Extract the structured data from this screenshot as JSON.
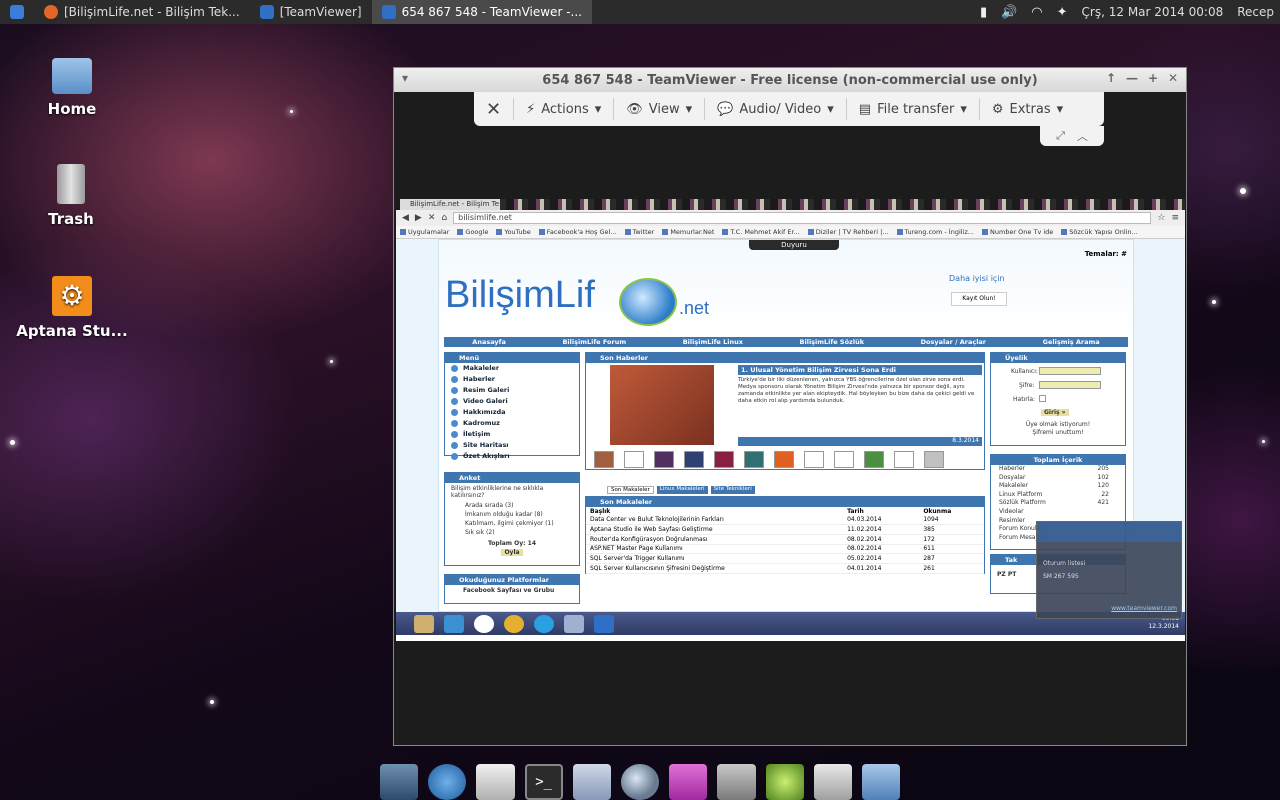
{
  "top_panel": {
    "tasks": [
      {
        "label": "[BilişimLife.net - Bilişim Tek...",
        "icon": "firefox-icon"
      },
      {
        "label": "[TeamViewer]",
        "icon": "teamviewer-icon"
      },
      {
        "label": "654 867 548 - TeamViewer -...",
        "icon": "teamviewer-icon",
        "active": true
      }
    ],
    "datetime": "Çrş, 12 Mar 2014 00:08",
    "user": "Recep"
  },
  "desktop_icons": [
    {
      "label": "Home",
      "icon": "home-folder-icon"
    },
    {
      "label": "Trash",
      "icon": "trash-icon"
    },
    {
      "label": "Aptana Stu...",
      "icon": "aptana-gear-icon"
    }
  ],
  "teamviewer": {
    "title": "654 867 548 - TeamViewer - Free license (non-commercial use only)",
    "toolbar": {
      "actions": "Actions",
      "view": "View",
      "audio_video": "Audio/ Video",
      "file_transfer": "File transfer",
      "extras": "Extras"
    }
  },
  "remote": {
    "tab_title": "BilişimLife.net - Bilişim Te",
    "url": "bilisimlife.net",
    "bookmarks": [
      "Uygulamalar",
      "Google",
      "YouTube",
      "Facebook'a Hoş Gel...",
      "Twitter",
      "Memurlar.Net",
      "T.C. Mehmet Akif Er...",
      "Diziler | TV Rehberi |...",
      "Tureng.com - İngiliz...",
      "Number One Tv ide",
      "Sözcük Yapısı Onlin..."
    ],
    "site": {
      "duyuru": "Duyuru",
      "temalar": "Temalar: #",
      "logo": "BilişimLif",
      "logo_suffix": ".net",
      "daha": "Daha iyisi için",
      "kayit": "Kayıt Olun!",
      "nav": [
        "Anasayfa",
        "BilişimLife Forum",
        "BilişimLife Linux",
        "BilişimLife Sözlük",
        "Dosyalar / Araçlar",
        "Gelişmiş Arama"
      ],
      "menu": {
        "title": "Menü",
        "items": [
          "Makaleler",
          "Haberler",
          "Resim Galeri",
          "Video Galeri",
          "Hakkımızda",
          "Kadromuz",
          "İletişim",
          "Site Haritası",
          "Özet Akışları"
        ]
      },
      "anket": {
        "title": "Anket",
        "question": "Bilişim etkinliklerine ne sıklıkla katılırsınız?",
        "options": [
          "Arada sırada  (3)",
          "İmkanım olduğu kadar  (8)",
          "Katılmam, ilgimi çekmiyor  (1)",
          "Sık sık  (2)"
        ],
        "total": "Toplam Oy: 14",
        "button": "Oyla"
      },
      "platform": {
        "title": "Okuduğunuz Platformlar",
        "item": "Facebook Sayfası ve Grubu"
      },
      "son_haberler": {
        "title": "Son Haberler",
        "headline": "1. Ulusal Yönetim Bilişim Zirvesi Sona Erdi",
        "body": "Türkiye'de bir ilki düzenlenen, yalnızca YBS öğrencilerine özel olan zirve sona erdi. Medya sponsoru olarak Yönetim Bilişim Zirvesi'nde yalnızca bir sponsor değil, aynı zamanda etkinlikte yer alan ekipteydik. Hal böyleyken bu bize daha da çekici geldi ve daha etkin rol alıp yardımda bulunduk.",
        "date": "8.3.2014"
      },
      "tabs": [
        "Son Makaleler",
        "Linux Makaleleri",
        "Site Teknikleri"
      ],
      "son_makaleler": {
        "title": "Son Makaleler",
        "headers": [
          "Başlık",
          "Tarih",
          "Okunma"
        ],
        "rows": [
          [
            "Data Center ve Bulut Teknolojilerinin Farkları",
            "04.03.2014",
            "1094"
          ],
          [
            "Aptana Studio ile Web Sayfası Geliştirme",
            "11.02.2014",
            "385"
          ],
          [
            "Router'da Konfigürasyon Doğrulanması",
            "08.02.2014",
            "172"
          ],
          [
            "ASP.NET Master Page Kullanımı",
            "08.02.2014",
            "611"
          ],
          [
            "SQL Server'da Trigger Kullanımı",
            "05.02.2014",
            "287"
          ],
          [
            "SQL Server Kullanıcısının Şifresini Değiştirme",
            "04.01.2014",
            "261"
          ]
        ]
      },
      "uyelik": {
        "title": "Üyelik",
        "kullanici": "Kullanıcı:",
        "sifre": "Şifre:",
        "hatirla": "Hatırla:",
        "giris": "Giriş »",
        "uye_olmak": "Üye olmak istiyorum!",
        "sifremi": "Şifremi unuttum!"
      },
      "toplam": {
        "title": "Toplam İçerik",
        "rows": [
          [
            "Haberler",
            "205"
          ],
          [
            "Dosyalar",
            "102"
          ],
          [
            "Makaleler",
            "120"
          ],
          [
            "Linux Platform",
            "22"
          ],
          [
            "Sözlük Platform",
            "421"
          ],
          [
            "Videolar",
            ""
          ],
          [
            "Resimler",
            ""
          ],
          [
            "Forum Konuları",
            ""
          ],
          [
            "Forum Mesajları",
            ""
          ]
        ]
      },
      "takvim": {
        "title": "Tak",
        "days": "PZ   PT"
      }
    },
    "popup": {
      "item": "Oturum listesi",
      "id": "SM 267 595",
      "link": "www.teamviewer.com"
    },
    "clock": {
      "time": "00:08",
      "date": "12.3.2014"
    }
  },
  "dock": [
    "display-icon",
    "browser-globe-icon",
    "mail-icon",
    "terminal-icon",
    "window-manager-icon",
    "search-magnifier-icon",
    "download-icon",
    "text-editor-icon",
    "music-icon",
    "image-viewer-icon",
    "folder-icon"
  ]
}
